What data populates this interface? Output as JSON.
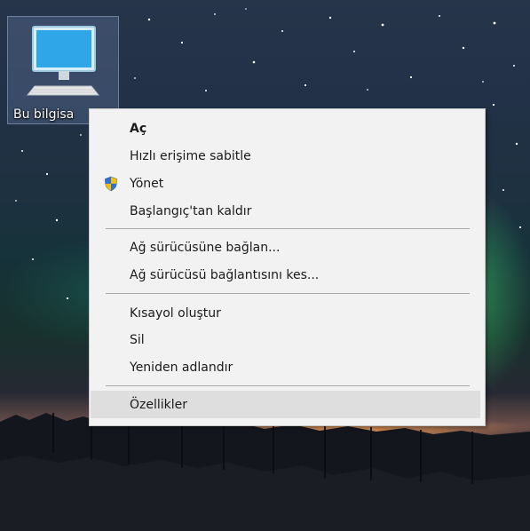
{
  "desktop": {
    "icon_label": "Bu bilgisa"
  },
  "context_menu": {
    "items": [
      {
        "label": "Aç",
        "is_default": true
      },
      {
        "label": "Hızlı erişime sabitle"
      },
      {
        "label": "Yönet",
        "icon": "uac-shield-icon"
      },
      {
        "label": "Başlangıç'tan kaldır"
      },
      {
        "label": "Ağ sürücüsüne bağlan..."
      },
      {
        "label": "Ağ sürücüsü bağlantısını kes..."
      },
      {
        "label": "Kısayol oluştur"
      },
      {
        "label": "Sil"
      },
      {
        "label": "Yeniden adlandır"
      },
      {
        "label": "Özellikler",
        "highlighted": true
      }
    ]
  },
  "colors": {
    "menu_background": "#f2f2f2",
    "menu_highlight": "#dedede",
    "menu_separator": "#a8a8a8",
    "shield_blue": "#2f6fd6",
    "shield_yellow": "#f2c200"
  }
}
